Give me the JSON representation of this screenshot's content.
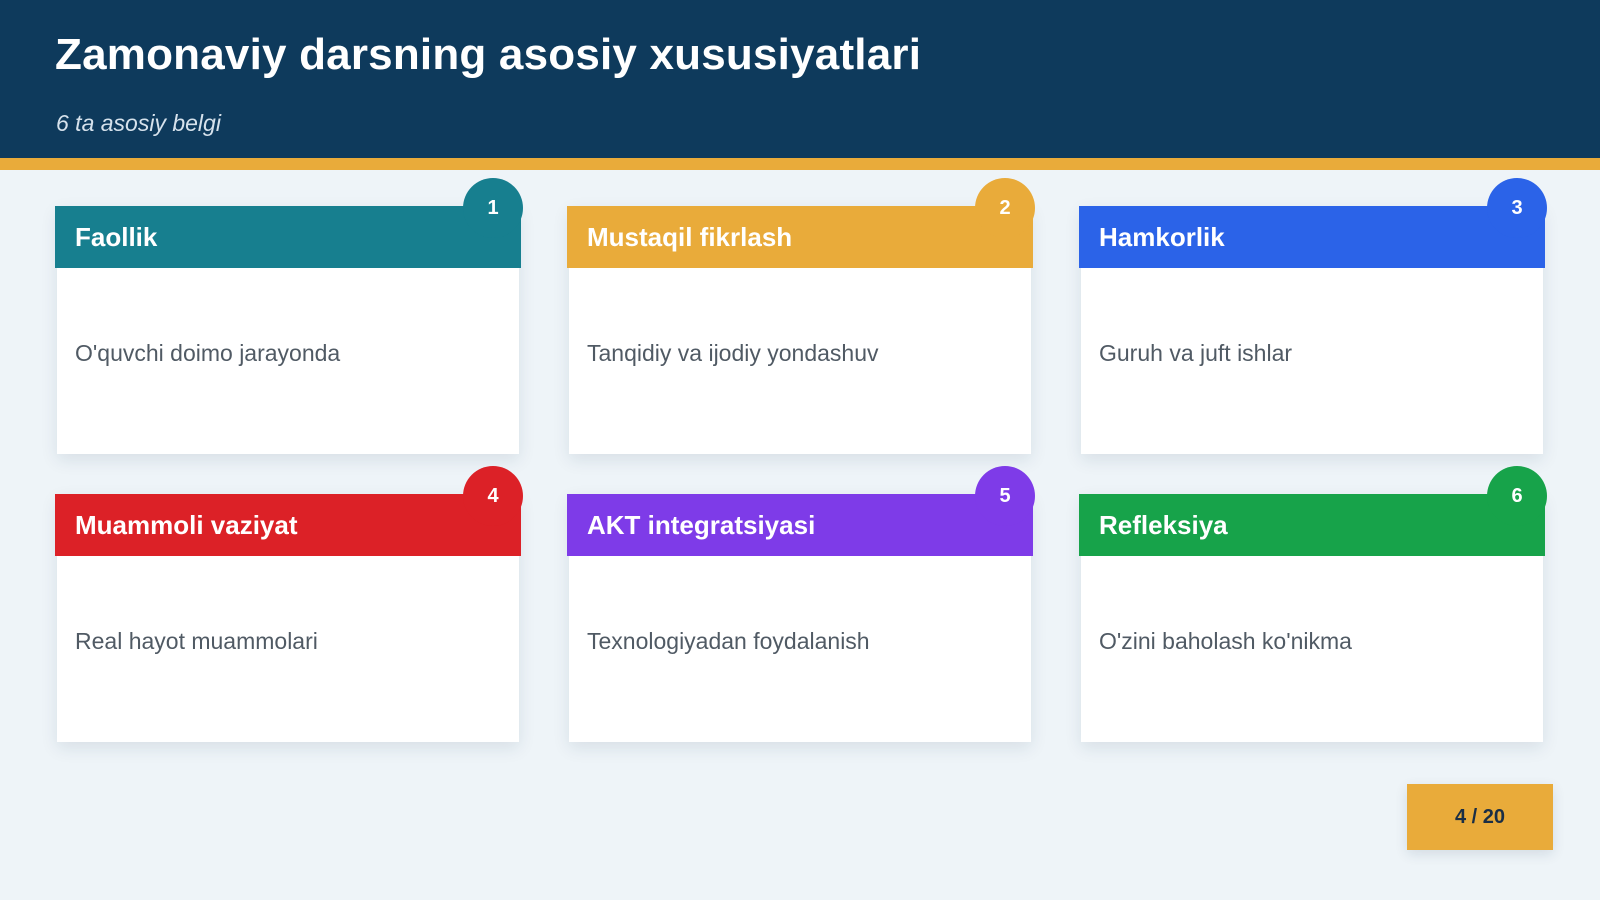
{
  "header": {
    "title": "Zamonaviy darsning asosiy xususiyatlari",
    "subtitle": "6 ta asosiy belgi"
  },
  "colors": {
    "header_bg": "#0e3a5c",
    "accent": "#e9ab3a",
    "background": "#eef4f8"
  },
  "cards": [
    {
      "number": "1",
      "title": "Faollik",
      "text": "O'quvchi doimo jarayonda",
      "color": "#177f8f"
    },
    {
      "number": "2",
      "title": "Mustaqil fikrlash",
      "text": "Tanqidiy va ijodiy yondashuv",
      "color": "#e9ab3a"
    },
    {
      "number": "3",
      "title": "Hamkorlik",
      "text": "Guruh va juft ishlar",
      "color": "#2b63e8"
    },
    {
      "number": "4",
      "title": "Muammoli vaziyat",
      "text": "Real hayot muammolari",
      "color": "#dc2127"
    },
    {
      "number": "5",
      "title": "AKT integratsiyasi",
      "text": "Texnologiyadan foydalanish",
      "color": "#7e3be8"
    },
    {
      "number": "6",
      "title": "Refleksiya",
      "text": "O'zini baholash ko'nikma",
      "color": "#17a34a"
    }
  ],
  "pagination": {
    "label": "4 / 20"
  }
}
